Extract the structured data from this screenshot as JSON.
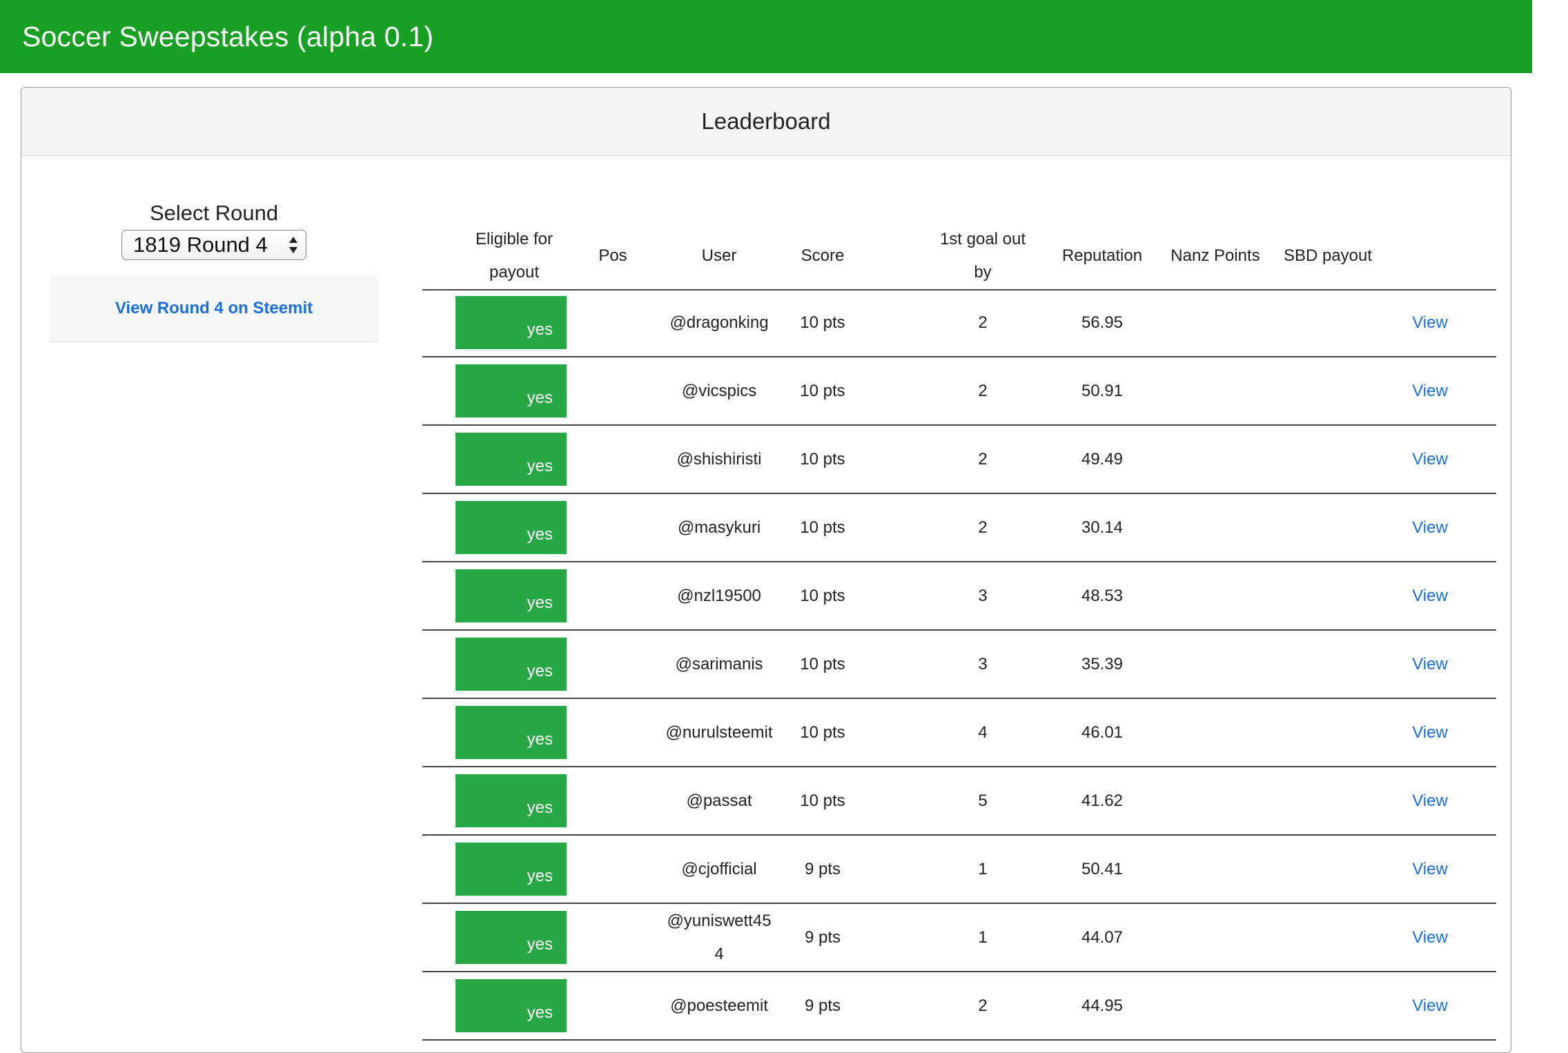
{
  "app": {
    "title": "Soccer Sweepstakes (alpha 0.1)"
  },
  "leaderboard": {
    "title": "Leaderboard",
    "select_label": "Select Round",
    "selected_round": "1819 Round 4",
    "steemit_link": "View Round 4 on Steemit"
  },
  "table": {
    "headers": {
      "eligible": "Eligible for payout",
      "pos": "Pos",
      "user": "User",
      "score": "Score",
      "first_goal": "1st goal out by",
      "reputation": "Reputation",
      "nanz": "Nanz Points",
      "sbd": "SBD payout"
    },
    "rows": [
      {
        "eligible": "yes",
        "pos": "",
        "user": "@dragonking",
        "score": "10 pts",
        "first_goal": "2",
        "reputation": "56.95",
        "nanz": "",
        "sbd": "",
        "action": "View"
      },
      {
        "eligible": "yes",
        "pos": "",
        "user": "@vicspics",
        "score": "10 pts",
        "first_goal": "2",
        "reputation": "50.91",
        "nanz": "",
        "sbd": "",
        "action": "View"
      },
      {
        "eligible": "yes",
        "pos": "",
        "user": "@shishiristi",
        "score": "10 pts",
        "first_goal": "2",
        "reputation": "49.49",
        "nanz": "",
        "sbd": "",
        "action": "View"
      },
      {
        "eligible": "yes",
        "pos": "",
        "user": "@masykuri",
        "score": "10 pts",
        "first_goal": "2",
        "reputation": "30.14",
        "nanz": "",
        "sbd": "",
        "action": "View"
      },
      {
        "eligible": "yes",
        "pos": "",
        "user": "@nzl19500",
        "score": "10 pts",
        "first_goal": "3",
        "reputation": "48.53",
        "nanz": "",
        "sbd": "",
        "action": "View"
      },
      {
        "eligible": "yes",
        "pos": "",
        "user": "@sarimanis",
        "score": "10 pts",
        "first_goal": "3",
        "reputation": "35.39",
        "nanz": "",
        "sbd": "",
        "action": "View"
      },
      {
        "eligible": "yes",
        "pos": "",
        "user": "@nurulsteemit",
        "score": "10 pts",
        "first_goal": "4",
        "reputation": "46.01",
        "nanz": "",
        "sbd": "",
        "action": "View"
      },
      {
        "eligible": "yes",
        "pos": "",
        "user": "@passat",
        "score": "10 pts",
        "first_goal": "5",
        "reputation": "41.62",
        "nanz": "",
        "sbd": "",
        "action": "View"
      },
      {
        "eligible": "yes",
        "pos": "",
        "user": "@cjofficial",
        "score": "9 pts",
        "first_goal": "1",
        "reputation": "50.41",
        "nanz": "",
        "sbd": "",
        "action": "View"
      },
      {
        "eligible": "yes",
        "pos": "",
        "user": "@yuniswett454",
        "score": "9 pts",
        "first_goal": "1",
        "reputation": "44.07",
        "nanz": "",
        "sbd": "",
        "action": "View"
      },
      {
        "eligible": "yes",
        "pos": "",
        "user": "@poesteemit",
        "score": "9 pts",
        "first_goal": "2",
        "reputation": "44.95",
        "nanz": "",
        "sbd": "",
        "action": "View"
      }
    ]
  },
  "colors": {
    "header_green": "#18a025",
    "badge_green": "#28a745",
    "link_blue": "#1a6fe0"
  }
}
